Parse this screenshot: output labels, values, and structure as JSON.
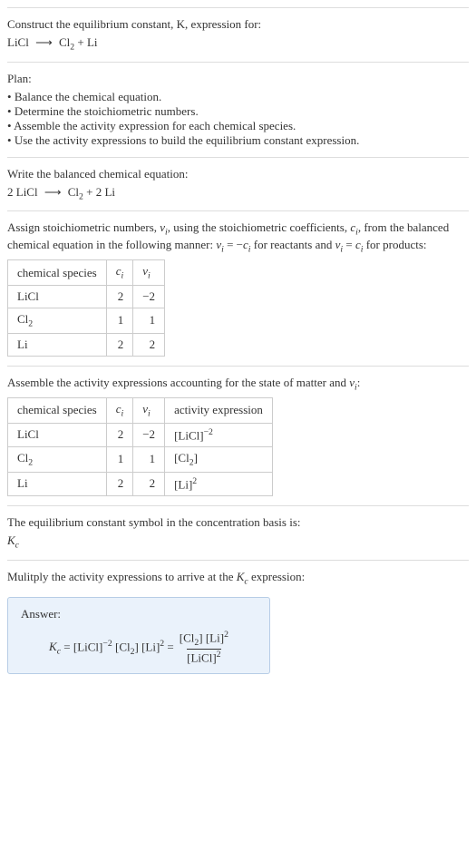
{
  "prompt": {
    "line1": "Construct the equilibrium constant, K, expression for:",
    "equation_html": "LiCl <span class='arrow'>⟶</span> Cl<span class='sub'>2</span> + Li"
  },
  "plan": {
    "title": "Plan:",
    "items": [
      "Balance the chemical equation.",
      "Determine the stoichiometric numbers.",
      "Assemble the activity expression for each chemical species.",
      "Use the activity expressions to build the equilibrium constant expression."
    ]
  },
  "balanced": {
    "title": "Write the balanced chemical equation:",
    "equation_html": "2 LiCl <span class='arrow'>⟶</span> Cl<span class='sub'>2</span> + 2 Li"
  },
  "stoich": {
    "intro_html": "Assign stoichiometric numbers, <span class='it'>ν<span class='sub'>i</span></span>, using the stoichiometric coefficients, <span class='it'>c<span class='sub'>i</span></span>, from the balanced chemical equation in the following manner: <span class='it'>ν<span class='sub'>i</span></span> = −<span class='it'>c<span class='sub'>i</span></span> for reactants and <span class='it'>ν<span class='sub'>i</span></span> = <span class='it'>c<span class='sub'>i</span></span> for products:",
    "headers": {
      "species": "chemical species",
      "ci_html": "<span class='it'>c<span class='sub'>i</span></span>",
      "vi_html": "<span class='it'>ν<span class='sub'>i</span></span>"
    },
    "rows": [
      {
        "species_html": "LiCl",
        "ci": "2",
        "vi": "−2"
      },
      {
        "species_html": "Cl<span class='sub'>2</span>",
        "ci": "1",
        "vi": "1"
      },
      {
        "species_html": "Li",
        "ci": "2",
        "vi": "2"
      }
    ]
  },
  "activity": {
    "intro_html": "Assemble the activity expressions accounting for the state of matter and <span class='it'>ν<span class='sub'>i</span></span>:",
    "headers": {
      "species": "chemical species",
      "ci_html": "<span class='it'>c<span class='sub'>i</span></span>",
      "vi_html": "<span class='it'>ν<span class='sub'>i</span></span>",
      "activity": "activity expression"
    },
    "rows": [
      {
        "species_html": "LiCl",
        "ci": "2",
        "vi": "−2",
        "act_html": "[LiCl]<span class='sup'>−2</span>"
      },
      {
        "species_html": "Cl<span class='sub'>2</span>",
        "ci": "1",
        "vi": "1",
        "act_html": "[Cl<span class='sub'>2</span>]"
      },
      {
        "species_html": "Li",
        "ci": "2",
        "vi": "2",
        "act_html": "[Li]<span class='sup'>2</span>"
      }
    ]
  },
  "symbol": {
    "line1": "The equilibrium constant symbol in the concentration basis is:",
    "kc_html": "<span class='it'>K<span class='sub'>c</span></span>"
  },
  "multiply": {
    "line_html": "Mulitply the activity expressions to arrive at the <span class='it'>K<span class='sub'>c</span></span> expression:"
  },
  "answer": {
    "label": "Answer:",
    "lhs_html": "<span class='it'>K<span class='sub'>c</span></span> = [LiCl]<span class='sup'>−2</span> [Cl<span class='sub'>2</span>] [Li]<span class='sup'>2</span> =",
    "frac_num_html": "[Cl<span class='sub'>2</span>] [Li]<span class='sup'>2</span>",
    "frac_den_html": "[LiCl]<span class='sup'>2</span>"
  },
  "chart_data": {
    "type": "table",
    "tables": [
      {
        "title": "Stoichiometric numbers",
        "columns": [
          "chemical species",
          "c_i",
          "ν_i"
        ],
        "rows": [
          [
            "LiCl",
            2,
            -2
          ],
          [
            "Cl2",
            1,
            1
          ],
          [
            "Li",
            2,
            2
          ]
        ]
      },
      {
        "title": "Activity expressions",
        "columns": [
          "chemical species",
          "c_i",
          "ν_i",
          "activity expression"
        ],
        "rows": [
          [
            "LiCl",
            2,
            -2,
            "[LiCl]^-2"
          ],
          [
            "Cl2",
            1,
            1,
            "[Cl2]"
          ],
          [
            "Li",
            2,
            2,
            "[Li]^2"
          ]
        ]
      }
    ]
  }
}
